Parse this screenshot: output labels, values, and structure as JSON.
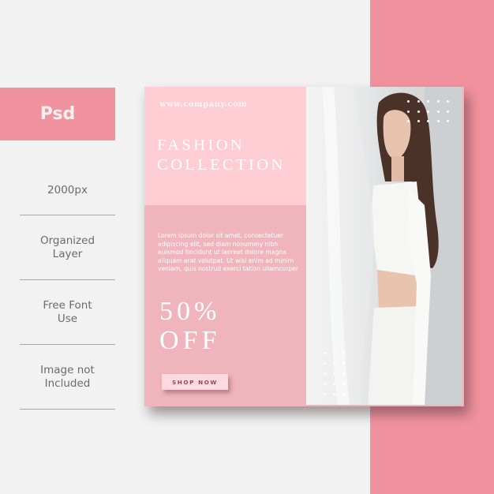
{
  "badge": {
    "label": "Psd"
  },
  "features": [
    {
      "label": "2000px"
    },
    {
      "label": "Organized\nLayer"
    },
    {
      "label": "Free Font\nUse"
    },
    {
      "label": "Image not\nIncluded"
    }
  ],
  "card": {
    "url": "www.company.com",
    "title": "FASHION\nCOLLECTION",
    "body": "Lorem ipsum dolor sit amet, consectetuer adipiscing elit, sed diam nonummy nibh euismod tincidunt ut laoreet dolore magna aliquam erat volutpat. Ut wisi enim ad minim veniam, quis nostrud exerci tation ullamcorper",
    "discount": "50%\nOFF",
    "button_label": "SHOP NOW",
    "photo_alt": "Model in white outfit standing beside sheer white curtain"
  },
  "colors": {
    "accent_pink": "#f1929f",
    "light_pink": "#ffcdd4",
    "mid_pink": "#f0b4bd",
    "background": "#f2f2f2"
  }
}
